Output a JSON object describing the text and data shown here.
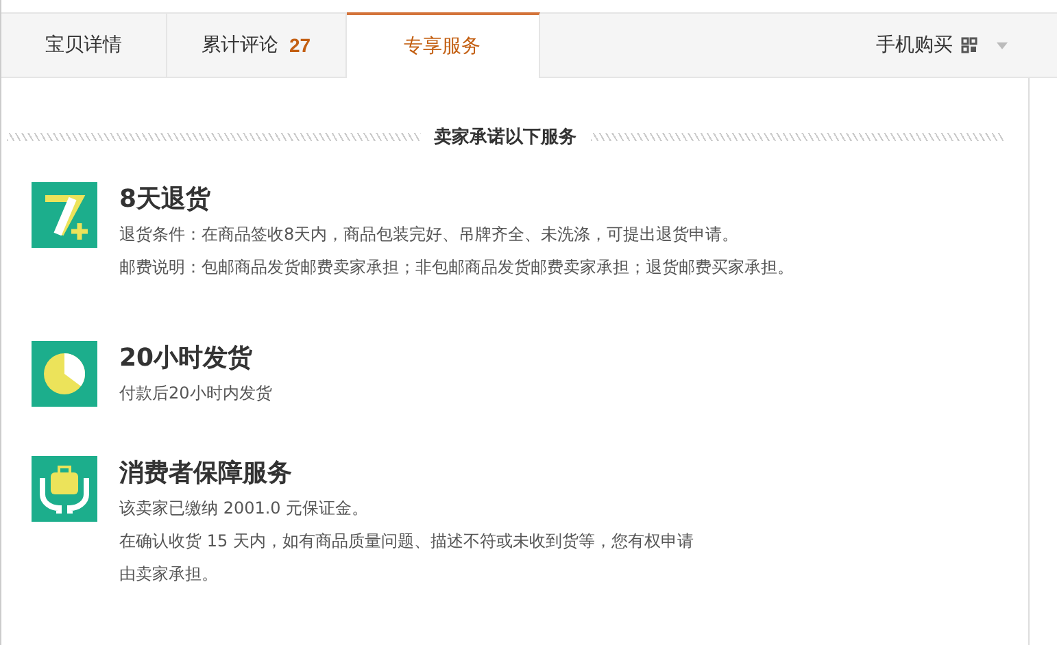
{
  "tabs": [
    {
      "label": "宝贝详情",
      "selected": false
    },
    {
      "label": "累计评论",
      "count": "27",
      "selected": false
    },
    {
      "label": "专享服务",
      "selected": true
    }
  ],
  "mobile_buy": {
    "label": "手机购买"
  },
  "heading": "卖家承诺以下服务",
  "services": [
    {
      "kind": "return",
      "title": "8天退货",
      "lines": [
        "退货条件：在商品签收8天内，商品包装完好、吊牌齐全、未洗涤，可提出退货申请。",
        "邮费说明：包邮商品发货邮费卖家承担；非包邮商品发货邮费卖家承担；退货邮费买家承担。"
      ]
    },
    {
      "kind": "clock",
      "title": "20小时发货",
      "lines": [
        "付款后20小时内发货"
      ]
    },
    {
      "kind": "guarantee",
      "title": "消费者保障服务",
      "lines": [
        "该卖家已缴纳 2001.0 元保证金。",
        "在确认收货 15 天内，如有商品质量问题、描述不符或未收到货等，您有权申请",
        "由卖家承担。"
      ]
    }
  ]
}
